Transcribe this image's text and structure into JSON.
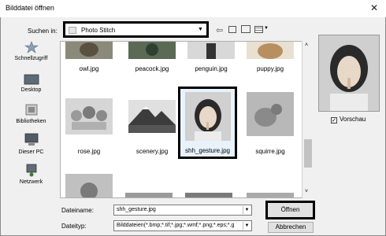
{
  "window": {
    "title": "Bilddatei öffnen",
    "close_icon": "✕"
  },
  "toolbar": {
    "lookin_label": "Suchen in:",
    "lookin_value": "Photo Stitch"
  },
  "places": [
    {
      "label": "Schnellzugriff",
      "icon": "star-icon"
    },
    {
      "label": "Desktop",
      "icon": "desktop-icon"
    },
    {
      "label": "Bibliotheken",
      "icon": "library-icon"
    },
    {
      "label": "Dieser PC",
      "icon": "computer-icon"
    },
    {
      "label": "Netzwerk",
      "icon": "network-icon"
    }
  ],
  "files": [
    {
      "name": "owl.jpg"
    },
    {
      "name": "peacock.jpg"
    },
    {
      "name": "penguin.jpg"
    },
    {
      "name": "puppy.jpg"
    },
    {
      "name": "rose.jpg"
    },
    {
      "name": "scenery.jpg"
    },
    {
      "name": "shh_gesture.jpg",
      "selected": true
    },
    {
      "name": "squirre.jpg"
    }
  ],
  "preview": {
    "checkbox_label": "Vorschau",
    "checked": true
  },
  "bottom": {
    "filename_label": "Dateiname:",
    "filename_value": "shh_gesture.jpg",
    "filetype_label": "Dateityp:",
    "filetype_value": "Bilddateien(*.bmp;*.tif;*.jpg;*.wmf;*.png;*.eps;*.g",
    "open_label": "Öffnen",
    "cancel_label": "Abbrechen"
  }
}
